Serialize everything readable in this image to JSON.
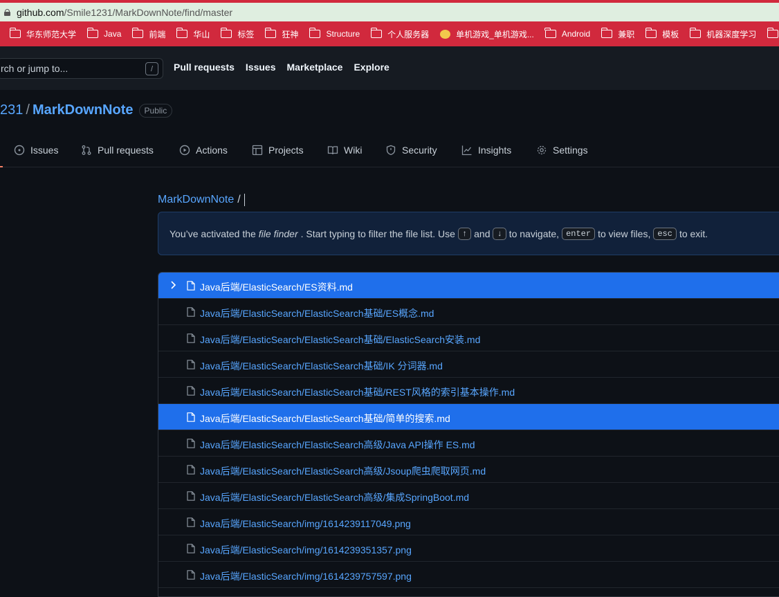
{
  "browser": {
    "url_host": "github.com",
    "url_path": "/Smile1231/MarkDownNote/find/master",
    "bookmarks": [
      "华东师范大学",
      "Java",
      "前端",
      "华山",
      "标签",
      "狂神",
      "Structure",
      "个人服务器",
      "单机游戏_单机游戏...",
      "Android",
      "兼职",
      "模板",
      "机器深度学习"
    ]
  },
  "header": {
    "search_placeholder": "rch or jump to...",
    "search_shortcut": "/",
    "nav": [
      "Pull requests",
      "Issues",
      "Marketplace",
      "Explore"
    ]
  },
  "repo": {
    "owner_fragment": "231",
    "separator": "/",
    "name": "MarkDownNote",
    "visibility": "Public"
  },
  "tabs": [
    {
      "label": "Issues",
      "icon": "issue-icon"
    },
    {
      "label": "Pull requests",
      "icon": "pull-request-icon"
    },
    {
      "label": "Actions",
      "icon": "play-icon"
    },
    {
      "label": "Projects",
      "icon": "table-icon"
    },
    {
      "label": "Wiki",
      "icon": "book-icon"
    },
    {
      "label": "Security",
      "icon": "shield-icon"
    },
    {
      "label": "Insights",
      "icon": "graph-icon"
    },
    {
      "label": "Settings",
      "icon": "gear-icon"
    }
  ],
  "finder": {
    "breadcrumb_repo": "MarkDownNote",
    "breadcrumb_sep": "/",
    "notice": {
      "t1": "You’ve activated the",
      "em": "file finder",
      "t2": ". Start typing to filter the file list. Use",
      "key_up": "↑",
      "t3": "and",
      "key_down": "↓",
      "t4": "to navigate,",
      "key_enter": "enter",
      "t5": "to view files,",
      "key_esc": "esc",
      "t6": "to exit."
    },
    "files": [
      "Java后端/ElasticSearch/ES资料.md",
      "Java后端/ElasticSearch/ElasticSearch基础/ES概念.md",
      "Java后端/ElasticSearch/ElasticSearch基础/ElasticSearch安装.md",
      "Java后端/ElasticSearch/ElasticSearch基础/IK 分词器.md",
      "Java后端/ElasticSearch/ElasticSearch基础/REST风格的索引基本操作.md",
      "Java后端/ElasticSearch/ElasticSearch基础/简单的搜索.md",
      "Java后端/ElasticSearch/ElasticSearch高级/Java API操作 ES.md",
      "Java后端/ElasticSearch/ElasticSearch高级/Jsoup爬虫爬取网页.md",
      "Java后端/ElasticSearch/ElasticSearch高级/集成SpringBoot.md",
      "Java后端/ElasticSearch/img/1614239117049.png",
      "Java后端/ElasticSearch/img/1614239351357.png",
      "Java后端/ElasticSearch/img/1614239757597.png"
    ],
    "selected_index": 0,
    "hover_index": 5,
    "colors": {
      "active_row": "#1f6feb",
      "link": "#58a6ff"
    }
  }
}
